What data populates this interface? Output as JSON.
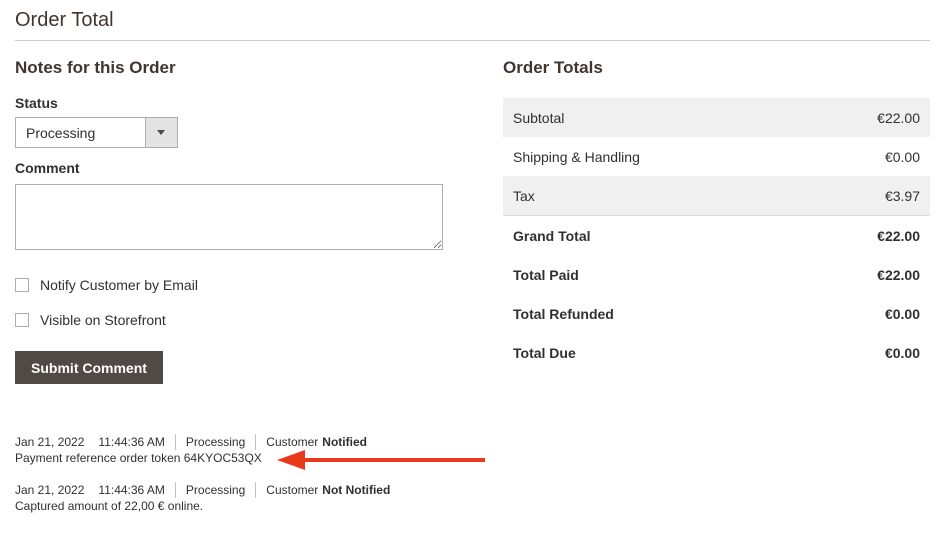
{
  "section": {
    "title": "Order Total"
  },
  "notes": {
    "title": "Notes for this Order",
    "status_label": "Status",
    "status_value": "Processing",
    "comment_label": "Comment",
    "notify_label": "Notify Customer by Email",
    "visible_label": "Visible on Storefront",
    "submit_label": "Submit Comment"
  },
  "history": [
    {
      "date": "Jan 21, 2022",
      "time": "11:44:36 AM",
      "status": "Processing",
      "customer": "Customer",
      "notified": "Notified",
      "comment": "Payment reference order token 64KYOC53QX"
    },
    {
      "date": "Jan 21, 2022",
      "time": "11:44:36 AM",
      "status": "Processing",
      "customer": "Customer",
      "notified": "Not Notified",
      "comment": "Captured amount of 22,00 € online."
    }
  ],
  "totals": {
    "title": "Order Totals",
    "rows": [
      {
        "label": "Subtotal",
        "value": "€22.00"
      },
      {
        "label": "Shipping & Handling",
        "value": "€0.00"
      },
      {
        "label": "Tax",
        "value": "€3.97"
      },
      {
        "label": "Grand Total",
        "value": "€22.00"
      },
      {
        "label": "Total Paid",
        "value": "€22.00"
      },
      {
        "label": "Total Refunded",
        "value": "€0.00"
      },
      {
        "label": "Total Due",
        "value": "€0.00"
      }
    ]
  },
  "colors": {
    "button_bg": "#514943",
    "arrow": "#e8391d",
    "row_shade": "#f0f0f0"
  },
  "icons": {
    "dropdown": "triangle-down",
    "annotation": "red-arrow-left"
  }
}
